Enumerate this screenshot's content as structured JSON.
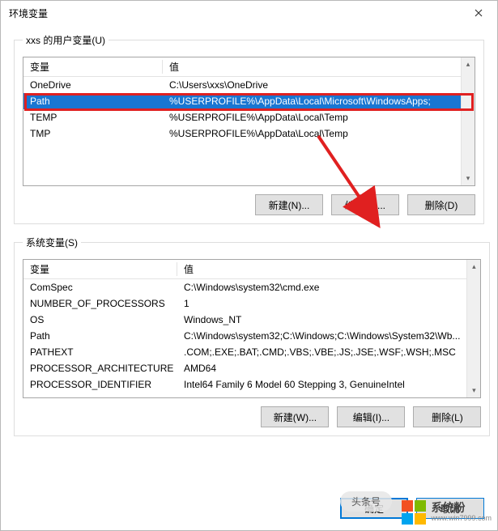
{
  "window": {
    "title": "环境变量"
  },
  "user_section": {
    "legend": "xxs 的用户变量(U)",
    "columns": {
      "name": "变量",
      "value": "值"
    },
    "rows": [
      {
        "name": "OneDrive",
        "value": "C:\\Users\\xxs\\OneDrive",
        "selected": false
      },
      {
        "name": "Path",
        "value": "%USERPROFILE%\\AppData\\Local\\Microsoft\\WindowsApps;",
        "selected": true
      },
      {
        "name": "TEMP",
        "value": "%USERPROFILE%\\AppData\\Local\\Temp",
        "selected": false
      },
      {
        "name": "TMP",
        "value": "%USERPROFILE%\\AppData\\Local\\Temp",
        "selected": false
      }
    ],
    "buttons": {
      "new": "新建(N)...",
      "edit": "编辑(E)...",
      "delete": "删除(D)"
    }
  },
  "sys_section": {
    "legend": "系统变量(S)",
    "columns": {
      "name": "变量",
      "value": "值"
    },
    "rows": [
      {
        "name": "ComSpec",
        "value": "C:\\Windows\\system32\\cmd.exe"
      },
      {
        "name": "NUMBER_OF_PROCESSORS",
        "value": "1"
      },
      {
        "name": "OS",
        "value": "Windows_NT"
      },
      {
        "name": "Path",
        "value": "C:\\Windows\\system32;C:\\Windows;C:\\Windows\\System32\\Wb..."
      },
      {
        "name": "PATHEXT",
        "value": ".COM;.EXE;.BAT;.CMD;.VBS;.VBE;.JS;.JSE;.WSF;.WSH;.MSC"
      },
      {
        "name": "PROCESSOR_ARCHITECTURE",
        "value": "AMD64"
      },
      {
        "name": "PROCESSOR_IDENTIFIER",
        "value": "Intel64 Family 6 Model 60 Stepping 3, GenuineIntel"
      }
    ],
    "buttons": {
      "new": "新建(W)...",
      "edit": "编辑(I)...",
      "delete": "删除(L)"
    }
  },
  "footer": {
    "ok": "确定",
    "cancel": "取消"
  },
  "watermark": {
    "brand": "系统粉",
    "url": "www.win7999.com"
  },
  "toast": "头条号"
}
